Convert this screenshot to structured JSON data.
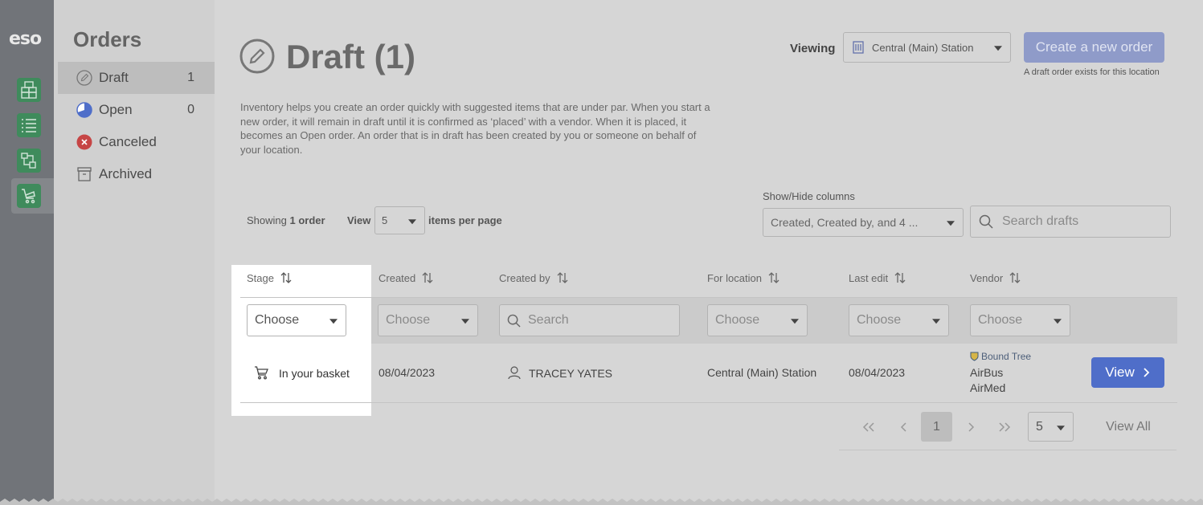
{
  "app": {
    "logo": "eso"
  },
  "rail": {
    "items": [
      {
        "icon": "grid-icon",
        "active": false
      },
      {
        "icon": "list-icon",
        "active": false
      },
      {
        "icon": "transfer-icon",
        "active": false
      },
      {
        "icon": "cart-icon",
        "active": true
      }
    ]
  },
  "subnav": {
    "title": "Orders",
    "items": [
      {
        "label": "Draft",
        "count": "1",
        "icon": "pencil-icon",
        "active": true
      },
      {
        "label": "Open",
        "count": "0",
        "icon": "progress-icon"
      },
      {
        "label": "Canceled",
        "icon": "x-circle-icon"
      },
      {
        "label": "Archived",
        "icon": "archive-icon"
      }
    ]
  },
  "header": {
    "title": "Draft (1)",
    "viewing_label": "Viewing",
    "location": "Central (Main) Station",
    "create_label": "Create a new order",
    "create_note": "A draft order exists for this location"
  },
  "intro": "Inventory helps you create an order quickly with suggested items that are under par. When you start a new order, it will remain in draft until it is confirmed as ‘placed’ with a vendor. When it is placed, it becomes an Open order. An order that is in draft has been created by you or someone on behalf of your location.",
  "toolbar": {
    "showing_prefix": "Showing",
    "showing_count": "1 order",
    "view_label": "View",
    "per_page": "5",
    "items_label": "items per page",
    "columns_label": "Show/Hide columns",
    "columns_value": "Created, Created by, and 4 ...",
    "search_placeholder": "Search drafts"
  },
  "table": {
    "columns": [
      "Stage",
      "Created",
      "Created by",
      "For location",
      "Last edit",
      "Vendor"
    ],
    "filters": {
      "choose": "Choose",
      "search": "Search"
    },
    "rows": [
      {
        "stage": "In your basket",
        "created": "08/04/2023",
        "created_by": "TRACEY YATES",
        "location": "Central (Main) Station",
        "last_edit": "08/04/2023",
        "vendor_logo": "Bound Tree",
        "vendors": [
          "AirBus",
          "AirMed"
        ],
        "action": "View"
      }
    ]
  },
  "pagination": {
    "current": "1",
    "per_page": "5",
    "view_all": "View All"
  }
}
